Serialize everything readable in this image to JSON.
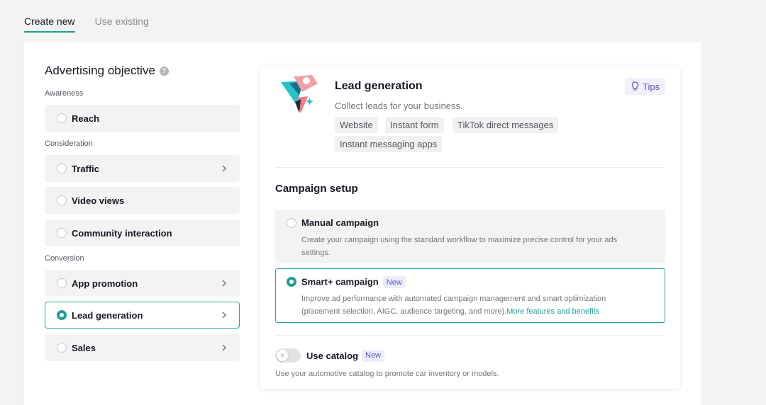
{
  "tabs": [
    {
      "label": "Create new",
      "active": true
    },
    {
      "label": "Use existing",
      "active": false
    }
  ],
  "objective": {
    "title": "Advertising objective",
    "help_icon": "question-mark-icon",
    "groups": {
      "awareness": "Awareness",
      "consideration": "Consideration",
      "conversion": "Conversion"
    },
    "options": [
      {
        "label": "Reach",
        "has_chevron": false,
        "selected": false
      },
      {
        "label": "Traffic",
        "has_chevron": true,
        "selected": false
      },
      {
        "label": "Video views",
        "has_chevron": false,
        "selected": false
      },
      {
        "label": "Community interaction",
        "has_chevron": false,
        "selected": false
      },
      {
        "label": "App promotion",
        "has_chevron": true,
        "selected": false
      },
      {
        "label": "Lead generation",
        "has_chevron": true,
        "selected": true
      },
      {
        "label": "Sales",
        "has_chevron": true,
        "selected": false
      }
    ]
  },
  "detail": {
    "title": "Lead generation",
    "description": "Collect leads for your business.",
    "tips_label": "Tips",
    "tips_icon": "lightbulb-icon",
    "chips": [
      "Website",
      "Instant form",
      "TikTok direct messages",
      "Instant messaging apps"
    ]
  },
  "campaign_setup": {
    "title": "Campaign setup",
    "manual": {
      "title": "Manual campaign",
      "description": "Create your campaign using the standard workflow to maximize precise control for your ads settings.",
      "selected": false
    },
    "smart": {
      "title": "Smart+ campaign",
      "badge": "New",
      "description": "Improve ad performance with automated campaign management and smart optimization (placement selection, AIGC, audience targeting, and more).",
      "link": "More features and benefits",
      "selected": true
    }
  },
  "catalog": {
    "label": "Use catalog",
    "badge": "New",
    "description": "Use your automotive catalog to promote car inventory or models.",
    "enabled": false
  },
  "colors": {
    "accent": "#1f9f94",
    "badge_text": "#5b54c9",
    "badge_bg": "#eeedfb"
  }
}
